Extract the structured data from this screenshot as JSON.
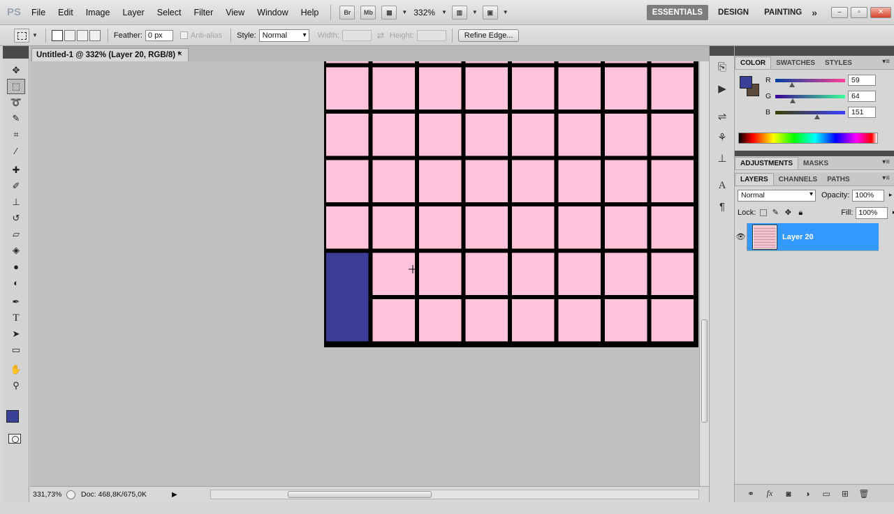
{
  "app": {
    "logo": "PS"
  },
  "menu": [
    "File",
    "Edit",
    "Image",
    "Layer",
    "Select",
    "Filter",
    "View",
    "Window",
    "Help"
  ],
  "menubar": {
    "bridge_label": "Br",
    "minibridge_label": "Mb",
    "zoom": "332%",
    "workspaces": [
      "ESSENTIALS",
      "DESIGN",
      "PAINTING"
    ],
    "more": "»"
  },
  "options": {
    "feather_label": "Feather:",
    "feather_value": "0 px",
    "antialias_label": "Anti-alias",
    "style_label": "Style:",
    "style_value": "Normal",
    "width_label": "Width:",
    "height_label": "Height:",
    "refine_edge": "Refine Edge..."
  },
  "document": {
    "tab_title": "Untitled-1 @ 332% (Layer 20, RGB/8) *",
    "close": "×",
    "grid_cols": 8,
    "grid_rows": 7,
    "cell_color": "#ffc4dc",
    "line_color": "#000000",
    "filled_cell": {
      "row": 5,
      "col": 0,
      "rowspan": 2,
      "color": "#3b3c96"
    }
  },
  "status": {
    "zoom": "331,73%",
    "doc": "Doc: 468,8K/675,0K",
    "arrow": "▶"
  },
  "color_panel": {
    "tabs": [
      "COLOR",
      "SWATCHES",
      "STYLES"
    ],
    "foreground": "#3b4097",
    "background": "#5c4b3c",
    "r_label": "R",
    "r": "59",
    "g_label": "G",
    "g": "64",
    "b_label": "B",
    "b": "151"
  },
  "adjust_panel": {
    "tabs": [
      "ADJUSTMENTS",
      "MASKS"
    ]
  },
  "layers_panel": {
    "tabs": [
      "LAYERS",
      "CHANNELS",
      "PATHS"
    ],
    "blend_mode": "Normal",
    "opacity_label": "Opacity:",
    "opacity": "100%",
    "lock_label": "Lock:",
    "fill_label": "Fill:",
    "fill": "100%",
    "layer_name": "Layer 20"
  }
}
